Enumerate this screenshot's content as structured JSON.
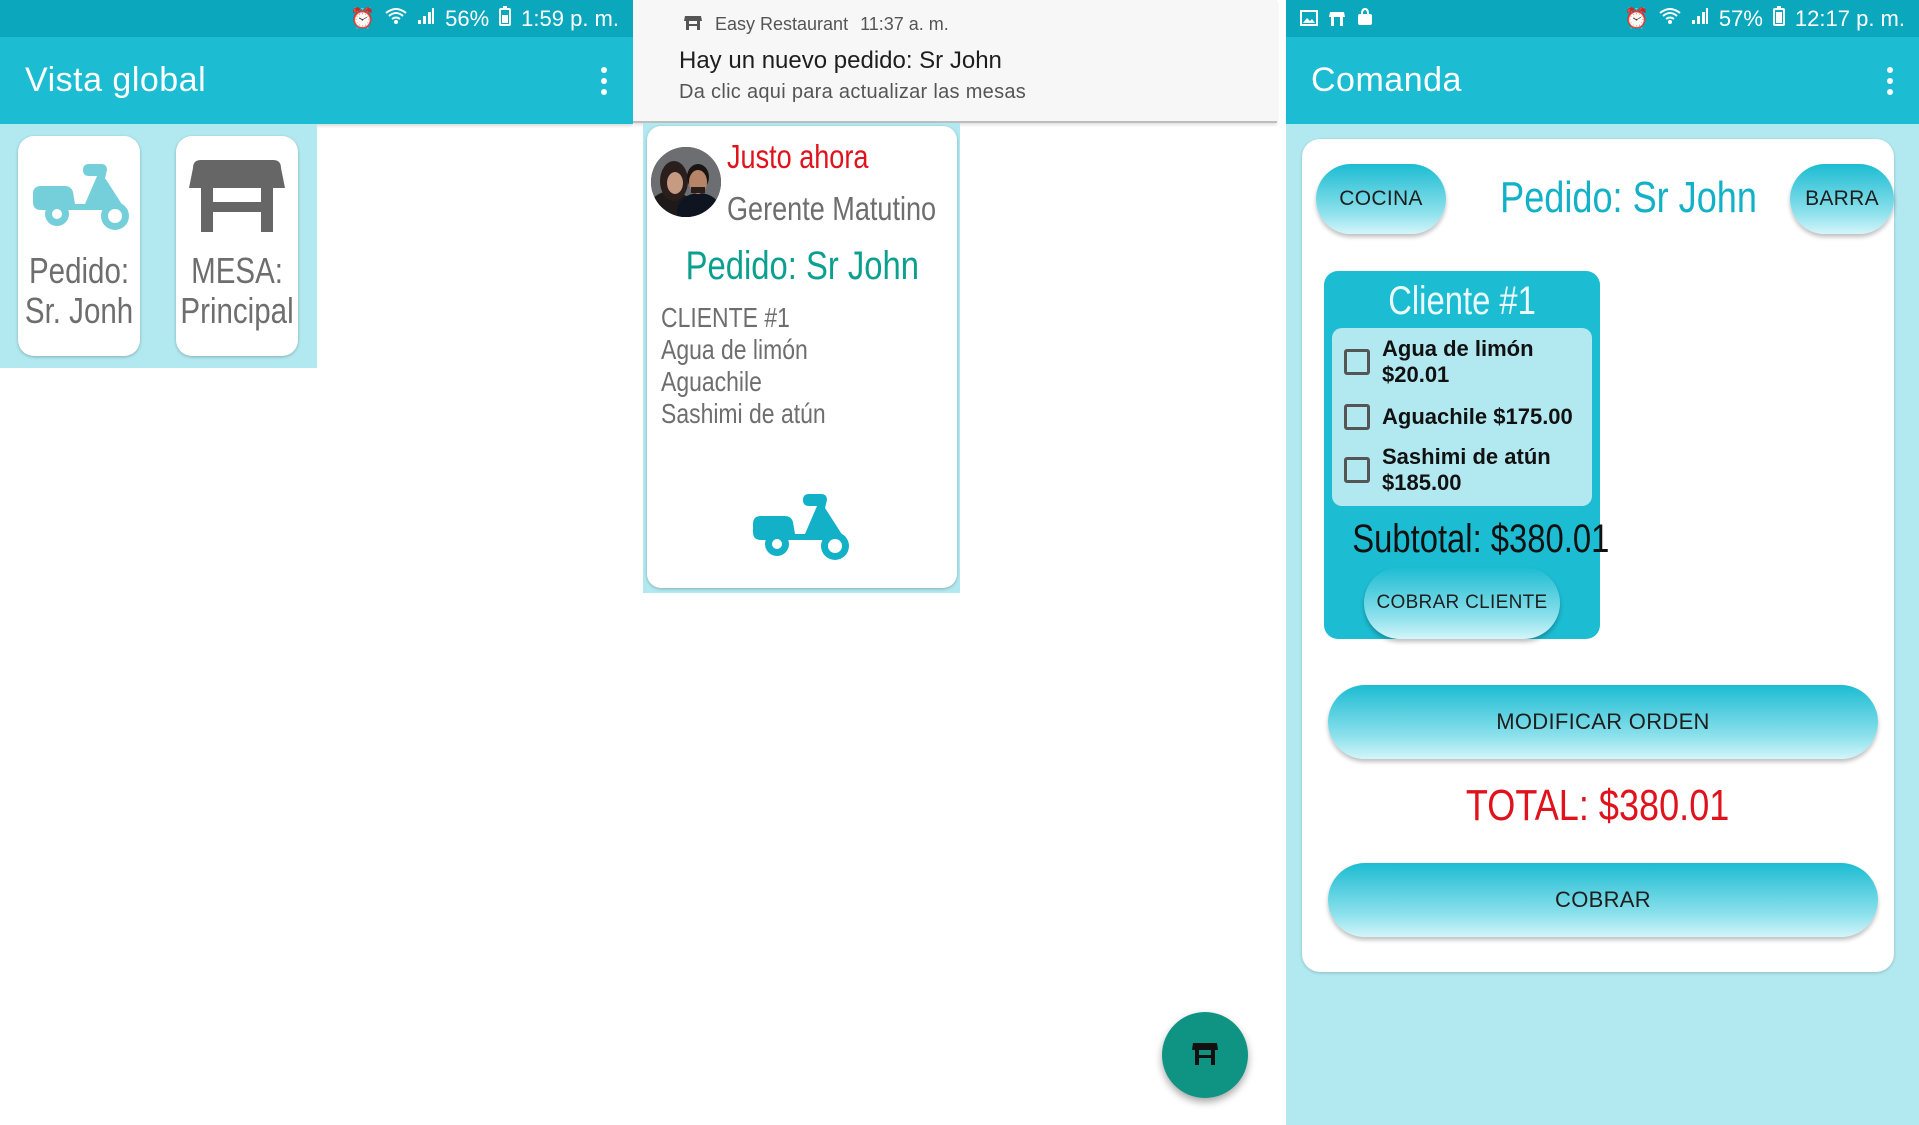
{
  "panel1": {
    "status_bar": {
      "battery": "56%",
      "time": "1:59 p. m."
    },
    "title": "Vista global",
    "tiles": [
      {
        "line1": "Pedido:",
        "line2": "Sr. Jonh",
        "icon": "scooter-icon"
      },
      {
        "line1": "MESA:",
        "line2": "Principal",
        "icon": "table-icon"
      }
    ]
  },
  "panel2": {
    "notification": {
      "app": "Easy Restaurant",
      "time": "11:37 a. m.",
      "title": "Hay un nuevo pedido: Sr John",
      "text": "Da clic aqui para actualizar las mesas"
    },
    "card": {
      "time": "Justo ahora",
      "author": "Gerente Matutino",
      "order": "Pedido: Sr John",
      "items": [
        "CLIENTE #1",
        "Agua de limón",
        "Aguachile",
        "Sashimi de atún"
      ]
    },
    "fab_icon": "table-icon"
  },
  "panel3": {
    "status_bar": {
      "battery": "57%",
      "time": "12:17 p. m."
    },
    "title": "Comanda",
    "kitchen_button": "COCINA",
    "bar_button": "BARRA",
    "order_title": "Pedido: Sr John",
    "client": {
      "title": "Cliente #1",
      "items": [
        {
          "line1": "Agua de limón",
          "line2": "$20.01",
          "checked": false
        },
        {
          "line1": "Aguachile $175.00",
          "line2": "",
          "checked": false
        },
        {
          "line1": "Sashimi de atún",
          "line2": "$185.00",
          "checked": false
        }
      ],
      "subtotal": "Subtotal: $380.01",
      "charge_button": "COBRAR CLIENTE"
    },
    "modify_button": "MODIFICAR ORDEN",
    "total": "TOTAL: $380.01",
    "pay_button": "COBRAR"
  },
  "colors": {
    "primary": "#1cbcd2",
    "status_bar": "#0aa7bd",
    "light_bg": "#b2e9f1",
    "teal_text": "#0b9f8f",
    "fab": "#0f9484",
    "red": "#e0121b",
    "gray_text": "#6e6e6e"
  }
}
